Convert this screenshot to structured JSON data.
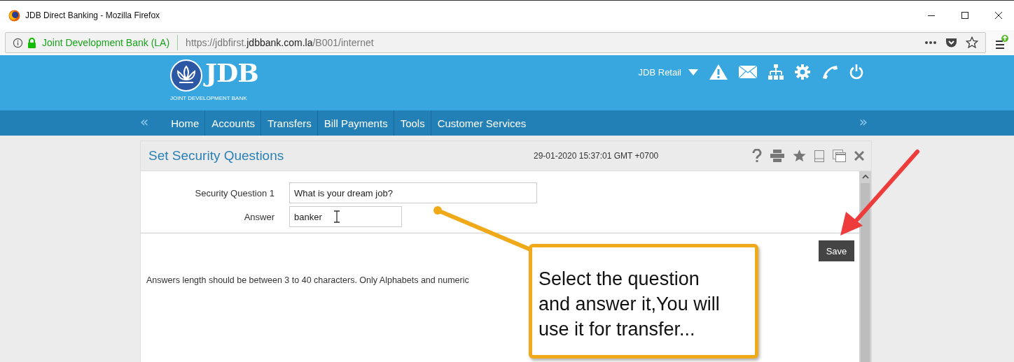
{
  "window": {
    "title": "JDB Direct Banking - Mozilla Firefox"
  },
  "address_bar": {
    "site_identity": "Joint Development Bank (LA)",
    "url_prefix": "https://jdbfirst.",
    "url_domain": "jdbbank.com.la",
    "url_path": "/B001/internet"
  },
  "header": {
    "logo_mark": "JDB",
    "logo_tagline": "JOINT DEVELOPMENT BANK",
    "user_menu": "JDB Retail"
  },
  "nav": {
    "prev": "«",
    "next": "»",
    "items": [
      {
        "label": "Home"
      },
      {
        "label": "Accounts"
      },
      {
        "label": "Transfers"
      },
      {
        "label": "Bill Payments"
      },
      {
        "label": "Tools"
      },
      {
        "label": "Customer Services"
      }
    ]
  },
  "panel": {
    "title": "Set Security Questions",
    "timestamp": "29-01-2020 15:37:01 GMT +0700",
    "fields": [
      {
        "kind": "question",
        "label": "Security Question 1",
        "value": "What is your dream job?"
      },
      {
        "kind": "answer",
        "label": "Answer",
        "value": "banker"
      }
    ],
    "save": "Save",
    "hint": "Answers length should be between 3 to 40 characters. Only Alphabets and numeric"
  },
  "callout": {
    "lines": [
      "Select the question",
      "and answer it,You will",
      "use it for transfer..."
    ]
  }
}
